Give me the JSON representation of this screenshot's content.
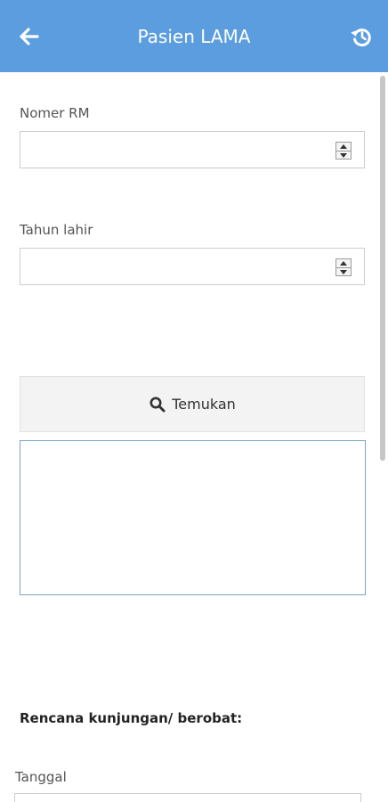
{
  "header": {
    "title": "Pasien LAMA",
    "back_icon": "arrow-left-icon",
    "history_icon": "history-icon",
    "background": "#5b9ddf"
  },
  "form": {
    "nomer_rm": {
      "label": "Nomer RM",
      "value": ""
    },
    "tahun_lahir": {
      "label": "Tahun lahir",
      "value": ""
    },
    "find_button": {
      "label": "Temukan",
      "icon": "search-icon"
    }
  },
  "visit_plan": {
    "title": "Rencana kunjungan/ berobat:",
    "date_label": "Tanggal",
    "date_value": ""
  }
}
